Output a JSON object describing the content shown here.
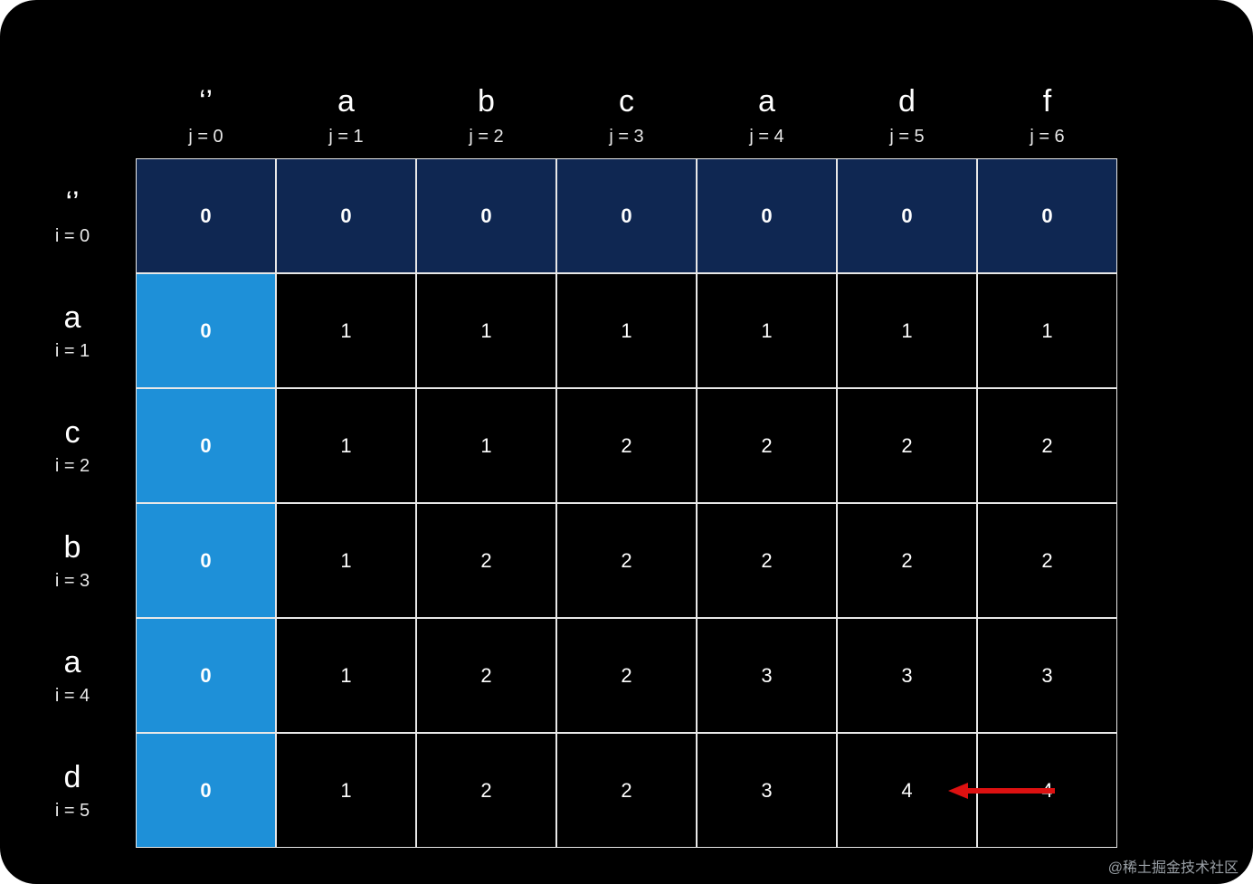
{
  "chart_data": {
    "type": "table",
    "title": "",
    "col_chars": [
      "‘’",
      "a",
      "b",
      "c",
      "a",
      "d",
      "f"
    ],
    "col_idx": [
      "j = 0",
      "j = 1",
      "j = 2",
      "j = 3",
      "j = 4",
      "j = 5",
      "j = 6"
    ],
    "row_chars": [
      "‘’",
      "a",
      "c",
      "b",
      "a",
      "d"
    ],
    "row_idx": [
      "i = 0",
      "i = 1",
      "i = 2",
      "i = 3",
      "i = 4",
      "i = 5"
    ],
    "values": [
      [
        "0",
        "0",
        "0",
        "0",
        "0",
        "0",
        "0"
      ],
      [
        "0",
        "1",
        "1",
        "1",
        "1",
        "1",
        "1"
      ],
      [
        "0",
        "1",
        "1",
        "2",
        "2",
        "2",
        "2"
      ],
      [
        "0",
        "1",
        "2",
        "2",
        "2",
        "2",
        "2"
      ],
      [
        "0",
        "1",
        "2",
        "2",
        "3",
        "3",
        "3"
      ],
      [
        "0",
        "1",
        "2",
        "2",
        "3",
        "4",
        "4"
      ]
    ],
    "arrow": {
      "from": [
        5,
        6
      ],
      "to": [
        5,
        5
      ],
      "color": "#e11"
    }
  },
  "watermark": "@稀土掘金技术社区"
}
